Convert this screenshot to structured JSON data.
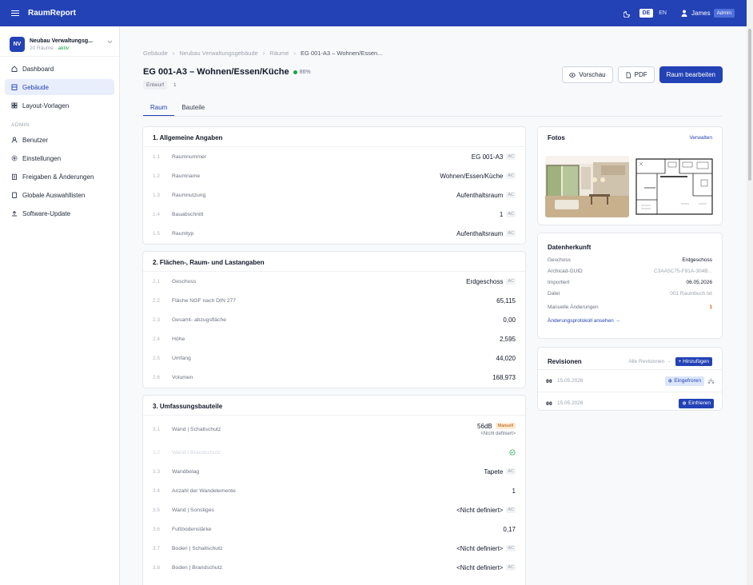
{
  "app": {
    "title": "RaumReport"
  },
  "header": {
    "lang_active": "DE",
    "lang_other": "EN",
    "user_name": "James",
    "user_role": "Admin"
  },
  "project": {
    "initials": "NV",
    "name": "Neubau Verwaltungsg...",
    "rooms": "20 Räume · ",
    "status": "aktiv"
  },
  "nav": {
    "main": [
      {
        "label": "Dashboard",
        "icon": "home-icon"
      },
      {
        "label": "Gebäude",
        "icon": "building-icon",
        "active": true
      },
      {
        "label": "Layout-Vorlagen",
        "icon": "layout-icon"
      }
    ],
    "admin_label": "ADMIN",
    "admin": [
      {
        "label": "Benutzer",
        "icon": "users-icon"
      },
      {
        "label": "Einstellungen",
        "icon": "gear-icon"
      },
      {
        "label": "Freigaben & Änderungen",
        "icon": "clipboard-icon"
      },
      {
        "label": "Globale Auswahllisten",
        "icon": "list-icon"
      },
      {
        "label": "Software-Update",
        "icon": "upload-icon"
      }
    ]
  },
  "breadcrumb": [
    "Gebäude",
    "Neubau Verwaltungsgebäude",
    "Räume",
    "EG 001-A3 – Wohnen/Essen..."
  ],
  "room": {
    "title": "EG 001-A3 – Wohnen/Essen/Küche",
    "percent": "86%",
    "status": "Entwurf",
    "version": "1"
  },
  "actions": {
    "preview": "Vorschau",
    "pdf": "PDF",
    "edit": "Raum bearbeiten"
  },
  "tabs": [
    "Raum",
    "Bauteile"
  ],
  "sections": [
    {
      "title": "1. Allgemeine Angaben",
      "rows": [
        {
          "num": "1.1",
          "label": "Raumnummer",
          "value": "EG 001-A3",
          "ac": "AC"
        },
        {
          "num": "1.2",
          "label": "Raumname",
          "value": "Wohnen/Essen/Küche",
          "ac": "AC"
        },
        {
          "num": "1.3",
          "label": "Raumnutzung",
          "value": "Aufenthaltsraum",
          "ac": "AC"
        },
        {
          "num": "1.4",
          "label": "Bauabschnitt",
          "value": "1",
          "ac": "AC"
        },
        {
          "num": "1.5",
          "label": "Raumtyp",
          "value": "Aufenthaltsraum",
          "ac": "AC"
        }
      ]
    },
    {
      "title": "2. Flächen-, Raum- und Lastangaben",
      "rows": [
        {
          "num": "2.1",
          "label": "Geschoss",
          "value": "Erdgeschoss",
          "ac": "AC"
        },
        {
          "num": "2.2",
          "label": "Fläche NGF nach DIN 277",
          "value": "65,115"
        },
        {
          "num": "2.3",
          "label": "Gesamt- abzugsfläche",
          "value": "0,00"
        },
        {
          "num": "2.4",
          "label": "Höhe",
          "value": "2,595"
        },
        {
          "num": "2.5",
          "label": "Umfang",
          "value": "44,020"
        },
        {
          "num": "2.6",
          "label": "Volumen",
          "value": "168,973"
        }
      ]
    },
    {
      "title": "3. Umfassungsbauteile",
      "rows": [
        {
          "num": "3.1",
          "label": "Wand | Schallschutz",
          "value": "56dB",
          "badge": "Manuell",
          "note": "<Nicht definiert>"
        },
        {
          "num": "3.2",
          "label": "Wand | Brandschutz",
          "value": "",
          "faded": true,
          "check": true
        },
        {
          "num": "3.3",
          "label": "Wandbelag",
          "value": "Tapete",
          "ac": "AC"
        },
        {
          "num": "3.4",
          "label": "Anzahl der Wandelemente",
          "value": "1"
        },
        {
          "num": "3.5",
          "label": "Wand | Sonstiges",
          "value": "<Nicht definiert>",
          "ac": "AC"
        },
        {
          "num": "3.6",
          "label": "Fußbodenstärke",
          "value": "0,17"
        },
        {
          "num": "3.7",
          "label": "Boden | Schallschutz",
          "value": "<Nicht definiert>",
          "ac": "AC"
        },
        {
          "num": "3.8",
          "label": "Boden | Brandschutz",
          "value": "<Nicht definiert>",
          "ac": "AC"
        }
      ]
    }
  ],
  "photos": {
    "title": "Fotos",
    "manage": "Verwalten"
  },
  "provenance": {
    "title": "Datenherkunft",
    "rows": [
      {
        "label": "Geschoss",
        "value": "Erdgeschoss"
      },
      {
        "label": "Archicad-GUID",
        "value": "C3AA5C75-F91A-304B...",
        "muted": true
      },
      {
        "label": "Importiert",
        "value": "06.05.2026"
      },
      {
        "label": "Datei",
        "value": "001 Raumbuch.txt",
        "muted": true
      },
      {
        "label": "Manuelle Änderungen",
        "value": "1",
        "orange": true
      }
    ],
    "link": "Änderungsprotokoll ansehen →"
  },
  "revisions": {
    "title": "Revisionen",
    "all": "Alle Revisionen →",
    "add": "+ Hinzufügen",
    "items": [
      {
        "num": "00",
        "date": "15.05.2026",
        "action": "Eingefroren",
        "frozen": true
      },
      {
        "num": "00",
        "date": "15.05.2026",
        "action": "Einfrieren",
        "frozen": false
      }
    ]
  },
  "colors": {
    "brand": "#2342b5",
    "active_bg": "#e8eefc",
    "success": "#16a34a",
    "warning": "#ea580c"
  }
}
